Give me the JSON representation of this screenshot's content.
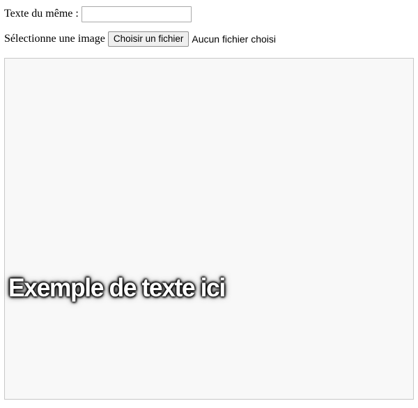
{
  "form": {
    "meme_text_label": "Texte du même :",
    "meme_text_value": "",
    "image_label": "Sélectionne une image",
    "file_button_label": "Choisir un fichier",
    "file_status": "Aucun fichier choisi"
  },
  "canvas": {
    "overlay_text": "Exemple de texte ici",
    "background_color": "#f8f8f8",
    "border_color": "#c8c8c8",
    "text_color": "#ffffff",
    "text_shadow_color": "#000000"
  }
}
